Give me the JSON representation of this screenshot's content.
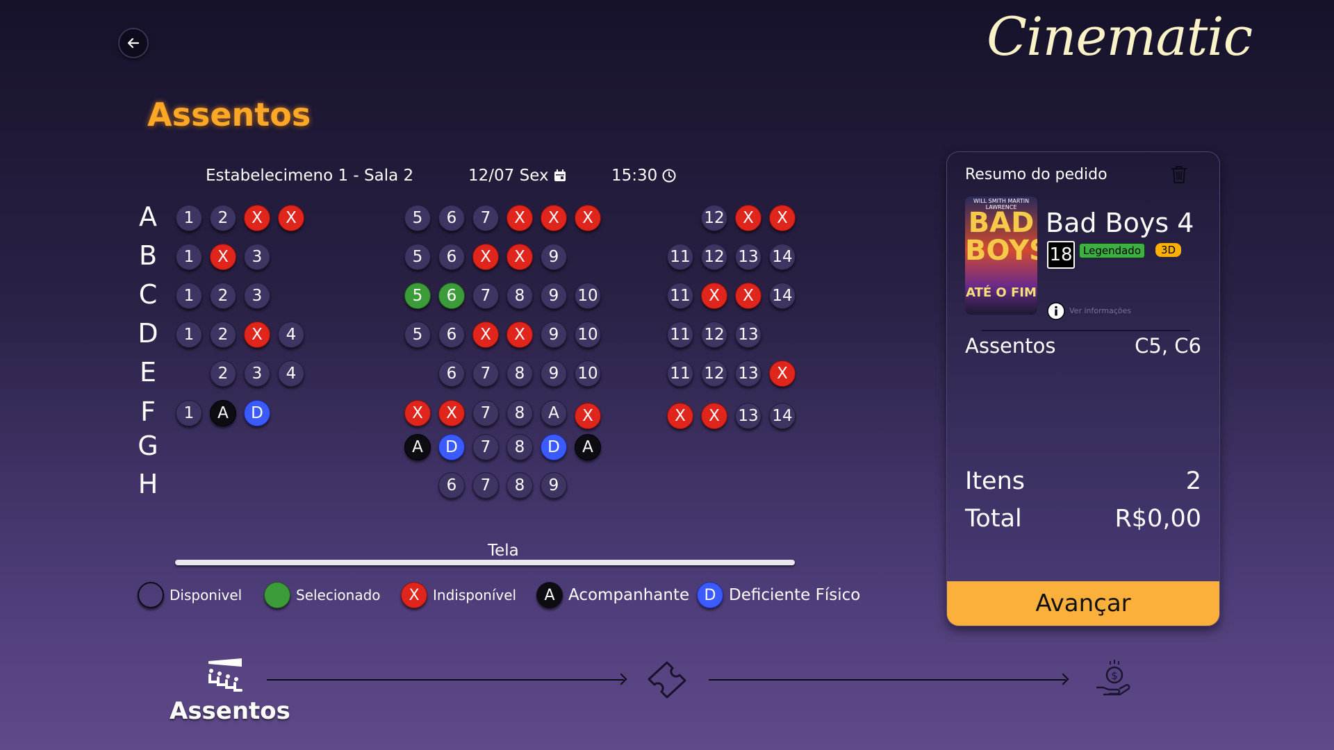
{
  "app": {
    "logo_text": "Cinematic"
  },
  "page": {
    "title": "Assentos"
  },
  "session": {
    "venue": "Estabelecimeno 1 - Sala 2",
    "date": "12/07 Sex",
    "time": "15:30"
  },
  "rows": [
    {
      "label": "A",
      "seats": [
        {
          "col": 1,
          "text": "1",
          "state": "available"
        },
        {
          "col": 2,
          "text": "2",
          "state": "available"
        },
        {
          "col": 3,
          "text": "X",
          "state": "unavailable"
        },
        {
          "col": 4,
          "text": "X",
          "state": "unavailable"
        },
        {
          "col": 5,
          "text": "5",
          "state": "available"
        },
        {
          "col": 6,
          "text": "6",
          "state": "available"
        },
        {
          "col": 7,
          "text": "7",
          "state": "available"
        },
        {
          "col": 8,
          "text": "X",
          "state": "unavailable"
        },
        {
          "col": 9,
          "text": "X",
          "state": "unavailable"
        },
        {
          "col": 10,
          "text": "X",
          "state": "unavailable"
        },
        {
          "col": 12,
          "text": "12",
          "state": "available"
        },
        {
          "col": 13,
          "text": "X",
          "state": "unavailable"
        },
        {
          "col": 14,
          "text": "X",
          "state": "unavailable"
        }
      ]
    },
    {
      "label": "B",
      "seats": [
        {
          "col": 1,
          "text": "1",
          "state": "available"
        },
        {
          "col": 2,
          "text": "X",
          "state": "unavailable"
        },
        {
          "col": 3,
          "text": "3",
          "state": "available"
        },
        {
          "col": 5,
          "text": "5",
          "state": "available"
        },
        {
          "col": 6,
          "text": "6",
          "state": "available"
        },
        {
          "col": 7,
          "text": "X",
          "state": "unavailable"
        },
        {
          "col": 8,
          "text": "X",
          "state": "unavailable"
        },
        {
          "col": 9,
          "text": "9",
          "state": "available"
        },
        {
          "col": 11,
          "text": "11",
          "state": "available"
        },
        {
          "col": 12,
          "text": "12",
          "state": "available"
        },
        {
          "col": 13,
          "text": "13",
          "state": "available"
        },
        {
          "col": 14,
          "text": "14",
          "state": "available"
        }
      ]
    },
    {
      "label": "C",
      "seats": [
        {
          "col": 1,
          "text": "1",
          "state": "available"
        },
        {
          "col": 2,
          "text": "2",
          "state": "available"
        },
        {
          "col": 3,
          "text": "3",
          "state": "available"
        },
        {
          "col": 5,
          "text": "5",
          "state": "selected"
        },
        {
          "col": 6,
          "text": "6",
          "state": "selected"
        },
        {
          "col": 7,
          "text": "7",
          "state": "available"
        },
        {
          "col": 8,
          "text": "8",
          "state": "available"
        },
        {
          "col": 9,
          "text": "9",
          "state": "available"
        },
        {
          "col": 10,
          "text": "10",
          "state": "available"
        },
        {
          "col": 11,
          "text": "11",
          "state": "available"
        },
        {
          "col": 12,
          "text": "X",
          "state": "unavailable"
        },
        {
          "col": 13,
          "text": "X",
          "state": "unavailable"
        },
        {
          "col": 14,
          "text": "14",
          "state": "available"
        }
      ]
    },
    {
      "label": "D",
      "seats": [
        {
          "col": 1,
          "text": "1",
          "state": "available"
        },
        {
          "col": 2,
          "text": "2",
          "state": "available"
        },
        {
          "col": 3,
          "text": "X",
          "state": "unavailable"
        },
        {
          "col": 4,
          "text": "4",
          "state": "available"
        },
        {
          "col": 5,
          "text": "5",
          "state": "available"
        },
        {
          "col": 6,
          "text": "6",
          "state": "available"
        },
        {
          "col": 7,
          "text": "X",
          "state": "unavailable"
        },
        {
          "col": 8,
          "text": "X",
          "state": "unavailable"
        },
        {
          "col": 9,
          "text": "9",
          "state": "available"
        },
        {
          "col": 10,
          "text": "10",
          "state": "available"
        },
        {
          "col": 11,
          "text": "11",
          "state": "available"
        },
        {
          "col": 12,
          "text": "12",
          "state": "available"
        },
        {
          "col": 13,
          "text": "13",
          "state": "available"
        }
      ]
    },
    {
      "label": "E",
      "seats": [
        {
          "col": 2,
          "text": "2",
          "state": "available"
        },
        {
          "col": 3,
          "text": "3",
          "state": "available"
        },
        {
          "col": 4,
          "text": "4",
          "state": "available"
        },
        {
          "col": 6,
          "text": "6",
          "state": "available"
        },
        {
          "col": 7,
          "text": "7",
          "state": "available"
        },
        {
          "col": 8,
          "text": "8",
          "state": "available"
        },
        {
          "col": 9,
          "text": "9",
          "state": "available"
        },
        {
          "col": 10,
          "text": "10",
          "state": "available"
        },
        {
          "col": 11,
          "text": "11",
          "state": "available"
        },
        {
          "col": 12,
          "text": "12",
          "state": "available"
        },
        {
          "col": 13,
          "text": "13",
          "state": "available"
        },
        {
          "col": 14,
          "text": "X",
          "state": "unavailable"
        }
      ]
    },
    {
      "label": "F",
      "seats": [
        {
          "col": 1,
          "text": "1",
          "state": "available"
        },
        {
          "col": 2,
          "text": "A",
          "state": "companion"
        },
        {
          "col": 3,
          "text": "D",
          "state": "disabled"
        },
        {
          "col": 5,
          "text": "X",
          "state": "unavailable"
        },
        {
          "col": 6,
          "text": "X",
          "state": "unavailable"
        },
        {
          "col": 7,
          "text": "7",
          "state": "available"
        },
        {
          "col": 8,
          "text": "8",
          "state": "available"
        },
        {
          "col": 9,
          "text": "A",
          "state": "available"
        },
        {
          "col": 10,
          "text": "X",
          "state": "unavailable"
        },
        {
          "col": 11,
          "text": "X",
          "state": "unavailable"
        },
        {
          "col": 12,
          "text": "X",
          "state": "unavailable"
        },
        {
          "col": 13,
          "text": "13",
          "state": "available"
        },
        {
          "col": 14,
          "text": "14",
          "state": "available"
        }
      ]
    },
    {
      "label": "G",
      "seats": [
        {
          "col": 5,
          "text": "A",
          "state": "companion"
        },
        {
          "col": 6,
          "text": "D",
          "state": "disabled"
        },
        {
          "col": 7,
          "text": "7",
          "state": "available"
        },
        {
          "col": 8,
          "text": "8",
          "state": "available"
        },
        {
          "col": 9,
          "text": "D",
          "state": "disabled"
        },
        {
          "col": 10,
          "text": "A",
          "state": "companion"
        }
      ]
    },
    {
      "label": "H",
      "seats": [
        {
          "col": 6,
          "text": "6",
          "state": "available"
        },
        {
          "col": 7,
          "text": "7",
          "state": "available"
        },
        {
          "col": 8,
          "text": "8",
          "state": "available"
        },
        {
          "col": 9,
          "text": "9",
          "state": "available"
        }
      ]
    }
  ],
  "screen": {
    "label": "Tela"
  },
  "legend": [
    {
      "key": "available",
      "symbol": "",
      "label": "Disponivel"
    },
    {
      "key": "selected",
      "symbol": "",
      "label": "Selecionado"
    },
    {
      "key": "unavailable",
      "symbol": "X",
      "label": "Indisponível"
    },
    {
      "key": "companion",
      "symbol": "A",
      "label": "Acompanhante"
    },
    {
      "key": "disabled",
      "symbol": "D",
      "label": "Deficiente Físico"
    }
  ],
  "order": {
    "title": "Resumo do pedido",
    "movie_title": "Bad Boys 4",
    "age_rating": "18",
    "badge_language": "Legendado",
    "badge_format": "3D",
    "more_info": "Ver informações",
    "poster": {
      "top_text": "WILL SMITH  MARTIN LAWRENCE",
      "title_line1": "BAD",
      "title_line2": "BOYS",
      "subtitle": "ATÉ O FIM"
    },
    "seats_label": "Assentos",
    "seats_value": "C5, C6",
    "items_label": "Itens",
    "items_value": "2",
    "total_label": "Total",
    "total_value": "R$0,00",
    "advance_label": "Avançar"
  },
  "steps": {
    "current_label": "Assentos",
    "icons": [
      "seats-icon",
      "ticket-icon",
      "payment-icon"
    ]
  },
  "colors": {
    "accent": "#ffa726",
    "available": "#3f3563",
    "selected": "#3d9c3a",
    "unavailable": "#e0251d",
    "companion": "#0d0c12",
    "disabled": "#3c5bff",
    "advance": "#fbb03b"
  }
}
